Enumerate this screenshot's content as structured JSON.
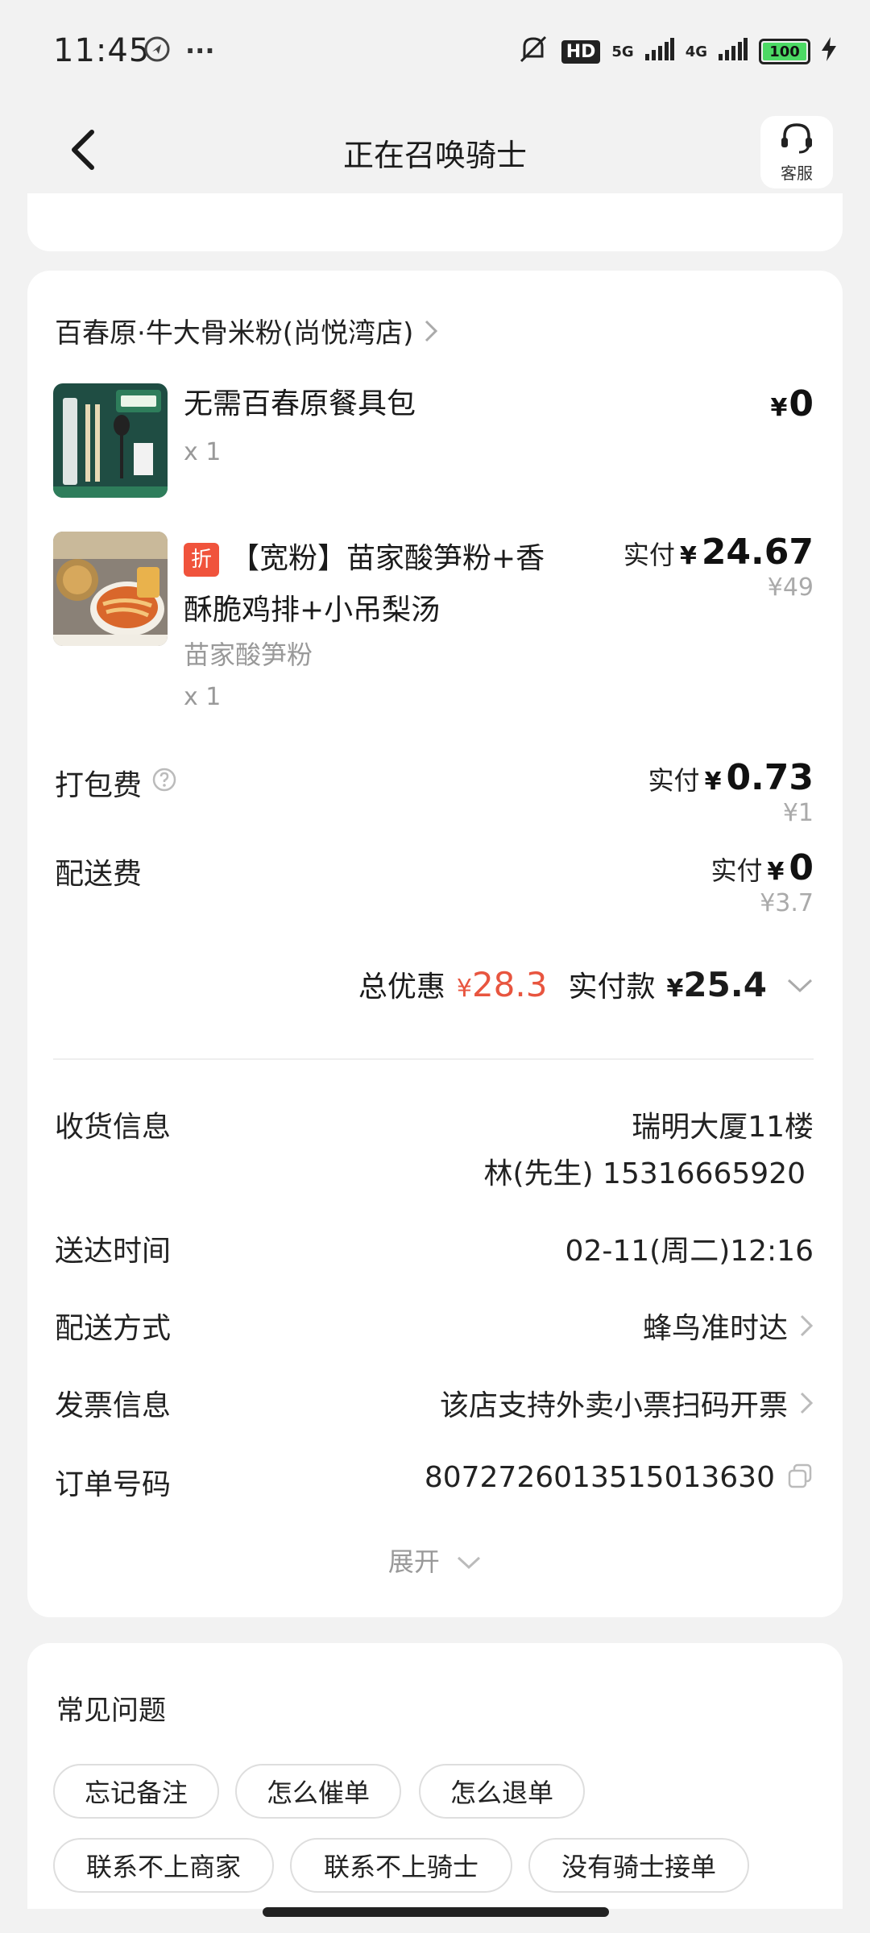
{
  "status_bar": {
    "time": "11:45",
    "dots": "···",
    "hd": "HD",
    "net1": "5G",
    "net2": "4G",
    "battery": "100"
  },
  "header": {
    "title": "正在召唤骑士",
    "cs_label": "客服"
  },
  "order": {
    "shop_name": "百春原·牛大骨米粉(尚悦湾店)",
    "items": [
      {
        "name": "无需百春原餐具包",
        "qty": "x 1",
        "yen": "¥",
        "price": "0"
      },
      {
        "badge": "折",
        "name_line1": "【宽粉】苗家酸笋粉+香",
        "name_line2": "酥脆鸡排+小吊梨汤",
        "spec": "苗家酸笋粉",
        "qty": "x 1",
        "paid_label": "实付",
        "yen": "¥",
        "price": "24.67",
        "orig_price": "¥49"
      }
    ],
    "packing": {
      "label": "打包费",
      "paid_label": "实付",
      "yen": "¥",
      "price": "0.73",
      "orig_price": "¥1"
    },
    "delivery_fee": {
      "label": "配送费",
      "paid_label": "实付",
      "yen": "¥",
      "price": "0",
      "orig_price": "¥3.7"
    },
    "totals": {
      "discount_label": "总优惠",
      "discount_yen": "¥",
      "discount_value": "28.3",
      "paid_label": "实付款",
      "paid_yen": "¥",
      "paid_value": "25.4"
    },
    "info": {
      "address_label": "收货信息",
      "address": "瑞明大厦11楼",
      "contact": "林(先生) 15316665920",
      "time_label": "送达时间",
      "time": "02-11(周二)12:16",
      "method_label": "配送方式",
      "method": "蜂鸟准时达",
      "invoice_label": "发票信息",
      "invoice": "该店支持外卖小票扫码开票",
      "order_no_label": "订单号码",
      "order_no": "8072726013515013630"
    },
    "expand_label": "展开"
  },
  "faq": {
    "title": "常见问题",
    "chips": [
      "忘记备注",
      "怎么催单",
      "怎么退单",
      "联系不上商家",
      "联系不上骑士",
      "没有骑士接单"
    ]
  },
  "colors": {
    "accent_red": "#e8553f",
    "background": "#f2f2f2"
  }
}
